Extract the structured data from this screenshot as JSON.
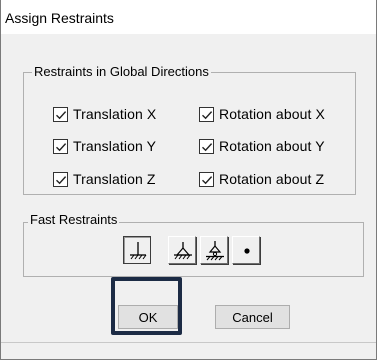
{
  "window": {
    "title": "Assign Restraints"
  },
  "global_directions": {
    "label": "Restraints in Global Directions",
    "translation": [
      {
        "label": "Translation X",
        "checked": true
      },
      {
        "label": "Translation Y",
        "checked": true
      },
      {
        "label": "Translation Z",
        "checked": true
      }
    ],
    "rotation": [
      {
        "label": "Rotation about X",
        "checked": true
      },
      {
        "label": "Rotation about Y",
        "checked": true
      },
      {
        "label": "Rotation about Z",
        "checked": true
      }
    ]
  },
  "fast_restraints": {
    "label": "Fast Restraints",
    "buttons": [
      {
        "icon": "fixed-support-icon",
        "selected": true
      },
      {
        "icon": "pinned-support-icon",
        "selected": false
      },
      {
        "icon": "roller-support-icon",
        "selected": false
      },
      {
        "icon": "free-joint-icon",
        "selected": false
      }
    ]
  },
  "buttons": {
    "ok": "OK",
    "cancel": "Cancel"
  },
  "colors": {
    "highlight": "#1c2b45",
    "dialog_bg": "#f0f0f0"
  }
}
